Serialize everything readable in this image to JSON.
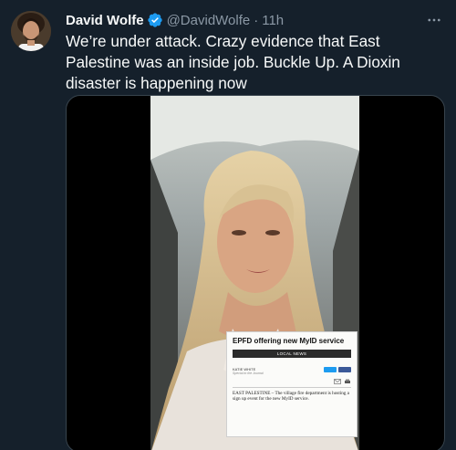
{
  "tweet": {
    "author": {
      "name": "David Wolfe",
      "handle": "@DavidWolfe",
      "verified": true,
      "avatar": "avatar"
    },
    "separator": "·",
    "time": "11h",
    "more_icon": "more-horizontal-icon",
    "text": "We’re under attack. Crazy evidence that East Palestine was an inside job. Buckle Up. A Dioxin disaster is happening now",
    "media": {
      "type": "video",
      "clipping": {
        "headline": "EPFD offering new MyID service",
        "section": "LOCAL NEWS",
        "author": "KATIE WHITE",
        "author_note": "Special to the Journal",
        "body": "EAST PALESTINE – The village fire department is hosting a sign up event for the new MyID service."
      }
    }
  },
  "colors": {
    "background": "#15202b",
    "text": "#f7f9f9",
    "secondary": "#8b98a5",
    "verified": "#1d9bf0",
    "border": "#38444d"
  }
}
